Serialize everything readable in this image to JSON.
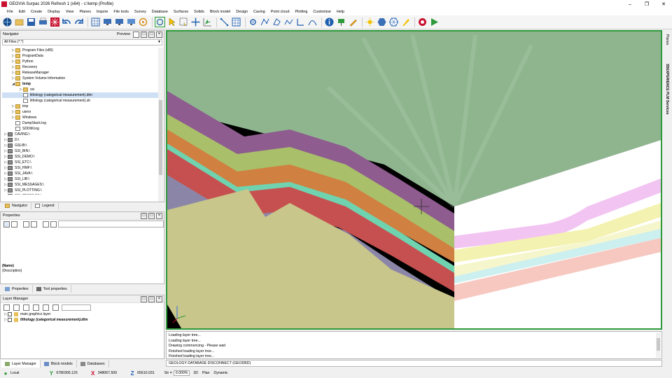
{
  "window": {
    "title": "GEOVIA Surpac 2026 Refresh 1 (x64) - c:\\temp (Profile)"
  },
  "menu": [
    "File",
    "Edit",
    "Create",
    "Display",
    "View",
    "Planes",
    "Inquire",
    "File tools",
    "Survey",
    "Database",
    "Surfaces",
    "Solids",
    "Block model",
    "Design",
    "Caving",
    "Point cloud",
    "Plotting",
    "Customise",
    "Help"
  ],
  "navigator": {
    "title": "Navigator",
    "preview_label": "Preview",
    "filter": "All Files (*.*)",
    "tree": [
      {
        "label": "Program Files (x86)",
        "type": "folder",
        "indent": 1
      },
      {
        "label": "ProgramData",
        "type": "folder",
        "indent": 1
      },
      {
        "label": "Python",
        "type": "folder",
        "indent": 1
      },
      {
        "label": "Recovery",
        "type": "folder",
        "indent": 1
      },
      {
        "label": "ReleaseManager",
        "type": "folder",
        "indent": 1
      },
      {
        "label": "System Volume Information",
        "type": "folder",
        "indent": 1
      },
      {
        "label": "temp",
        "type": "folder",
        "indent": 1,
        "expanded": true,
        "bold": true
      },
      {
        "label": "ssi",
        "type": "folder",
        "indent": 2
      },
      {
        "label": "lithology (categorical measurement).dtm",
        "type": "file",
        "indent": 2,
        "selected": true
      },
      {
        "label": "lithology (categorical measurement).str",
        "type": "file",
        "indent": 2
      },
      {
        "label": "tmp",
        "type": "folder",
        "indent": 1
      },
      {
        "label": "users",
        "type": "folder",
        "indent": 1
      },
      {
        "label": "Windows",
        "type": "folder",
        "indent": 1
      },
      {
        "label": "DumpStack.log",
        "type": "file",
        "indent": 1
      },
      {
        "label": "SDDiM.log",
        "type": "file",
        "indent": 1
      },
      {
        "label": "CAVING:\\",
        "type": "drive",
        "indent": 0
      },
      {
        "label": "D:\\",
        "type": "drive",
        "indent": 0
      },
      {
        "label": "GSLIB:\\",
        "type": "drive",
        "indent": 0
      },
      {
        "label": "SSI_BIN:\\",
        "type": "drive",
        "indent": 0
      },
      {
        "label": "SSI_DEMO:\\",
        "type": "drive",
        "indent": 0
      },
      {
        "label": "SSI_ETC:\\",
        "type": "drive",
        "indent": 0
      },
      {
        "label": "SSI_HMF:\\",
        "type": "drive",
        "indent": 0
      },
      {
        "label": "SSI_JAVA:\\",
        "type": "drive",
        "indent": 0
      },
      {
        "label": "SSI_LIB:\\",
        "type": "drive",
        "indent": 0
      },
      {
        "label": "SSI_MESSAGES:\\",
        "type": "drive",
        "indent": 0
      },
      {
        "label": "SSI_PLOTTING:\\",
        "type": "drive",
        "indent": 0
      },
      {
        "label": "SSI_PROFILES:\\",
        "type": "drive",
        "indent": 0
      }
    ],
    "tabs": [
      "Navigator",
      "Legend"
    ]
  },
  "properties": {
    "title": "Properties",
    "name": "(Name)",
    "description": "(Description)",
    "tabs": [
      "Properties",
      "Tool properties"
    ]
  },
  "layer_manager": {
    "title": "Layer Manager",
    "layers": [
      {
        "label": "main graphics layer",
        "italic": false
      },
      {
        "label": "lithology (categorical measurement).dtm",
        "italic": true
      }
    ],
    "tabs": [
      "Layer Manager",
      "Block models",
      "Databases"
    ]
  },
  "right_strip": [
    "Planes",
    "3DEXPERIENCE PLM Services"
  ],
  "output": {
    "lines": [
      "Loading layer tree...",
      "Loading layer tree...",
      "Drawing commencing - Please wait",
      "Finished loading layer tree...",
      "Finished loading layer tree..."
    ],
    "command": "GEOLOGY DATABASE DISCONNECT (GEODBD)"
  },
  "status": {
    "mode": "Local",
    "y": "6780305.125",
    "x": "348067.500",
    "z": "65610.031",
    "str_label": "Str =",
    "str_value": "0.000%",
    "view": "3D",
    "plan": "Plan",
    "dynamic": "Dynamic"
  },
  "colors": {
    "viewport_border": "#2e9a3c",
    "accent": "#1f6fb8"
  }
}
